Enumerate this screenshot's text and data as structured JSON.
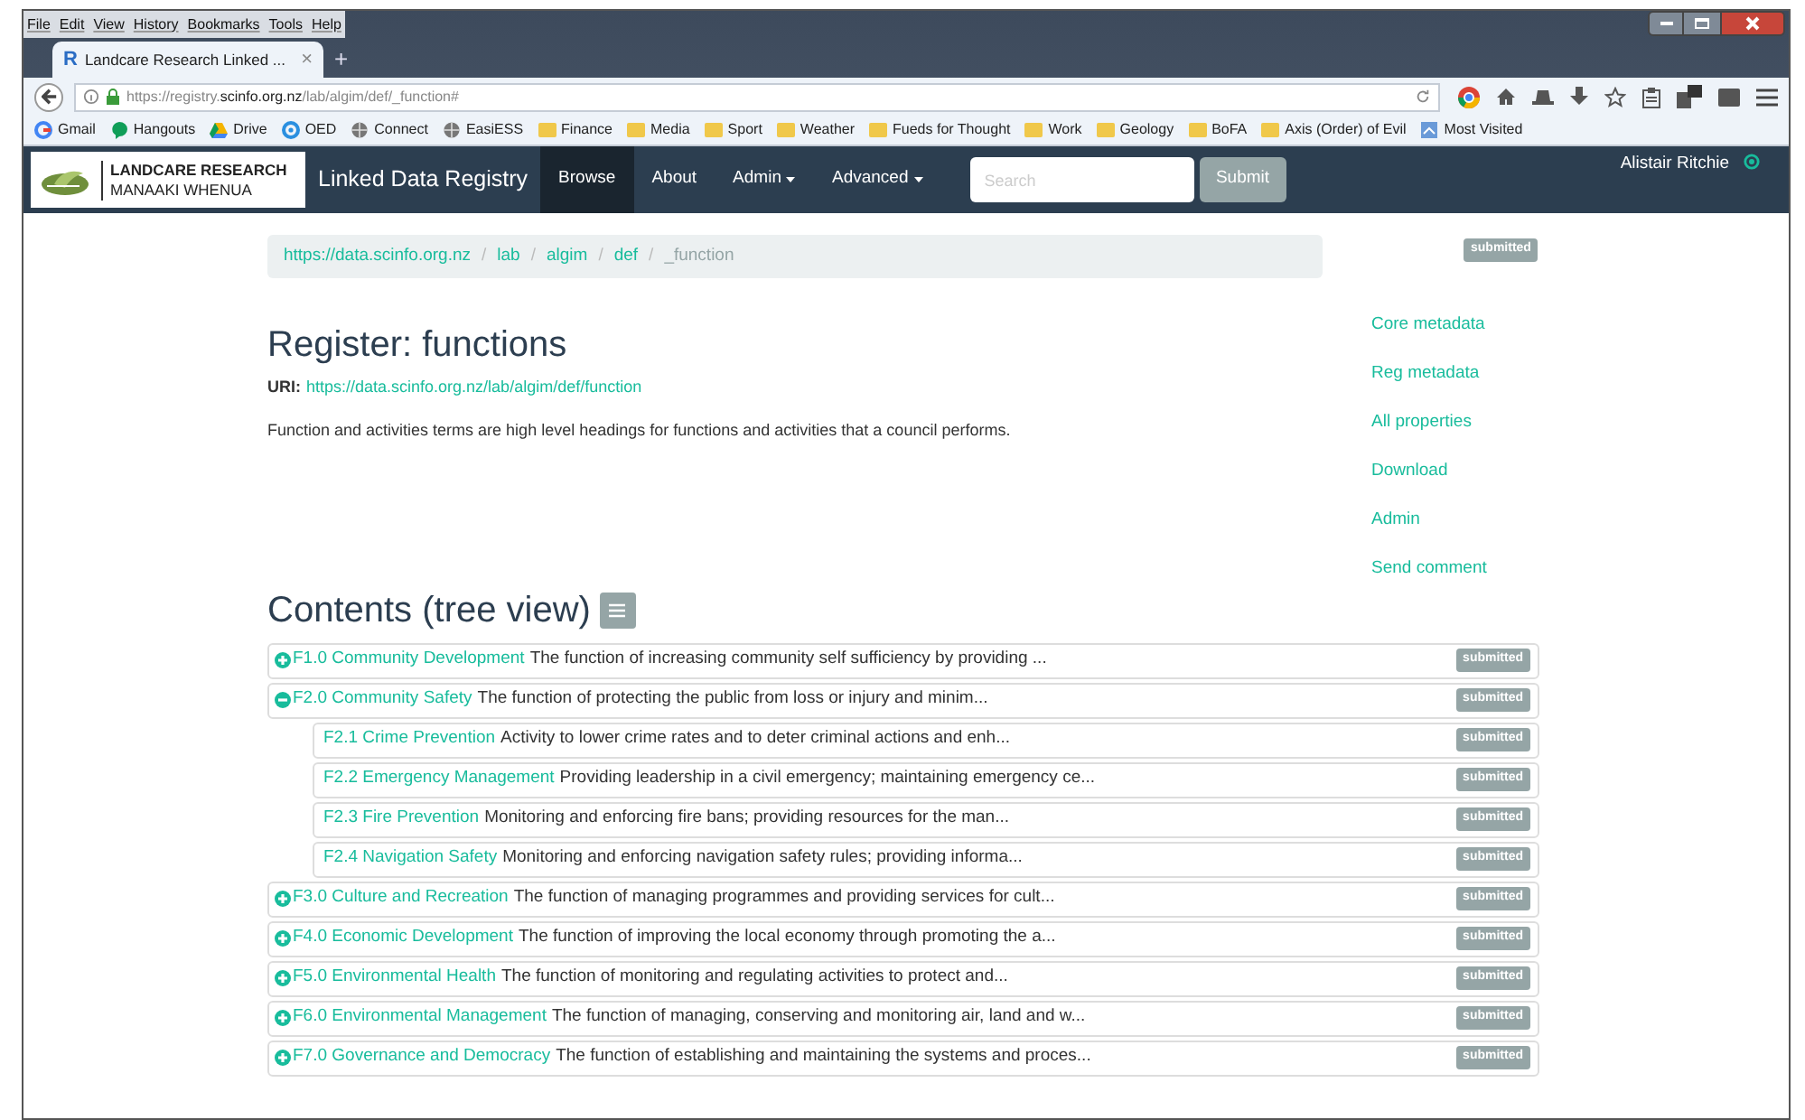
{
  "browser": {
    "menu": [
      "File",
      "Edit",
      "View",
      "History",
      "Bookmarks",
      "Tools",
      "Help"
    ],
    "tab": {
      "icon": "R",
      "title": "Landcare Research Linked ...",
      "close": "×"
    },
    "new_tab": "+",
    "url": {
      "prefix": "https://registry.",
      "host": "scinfo.org.nz",
      "path": "/lab/algim/def/_function#"
    },
    "bookmarks": [
      {
        "label": "Gmail",
        "kind": "google"
      },
      {
        "label": "Hangouts",
        "kind": "chat"
      },
      {
        "label": "Drive",
        "kind": "drive"
      },
      {
        "label": "OED",
        "kind": "ring"
      },
      {
        "label": "Connect",
        "kind": "globe"
      },
      {
        "label": "EasiESS",
        "kind": "globe"
      },
      {
        "label": "Finance",
        "kind": "folder"
      },
      {
        "label": "Media",
        "kind": "folder"
      },
      {
        "label": "Sport",
        "kind": "folder"
      },
      {
        "label": "Weather",
        "kind": "folder"
      },
      {
        "label": "Fueds for Thought",
        "kind": "folder"
      },
      {
        "label": "Work",
        "kind": "folder"
      },
      {
        "label": "Geology",
        "kind": "folder"
      },
      {
        "label": "BoFA",
        "kind": "folder"
      },
      {
        "label": "Axis (Order) of Evil",
        "kind": "folder"
      },
      {
        "label": "Most Visited",
        "kind": "page"
      }
    ]
  },
  "navbar": {
    "logo": {
      "line1": "LANDCARE RESEARCH",
      "line2": "MANAAKI WHENUA"
    },
    "brand": "Linked Data Registry",
    "items": [
      {
        "label": "Browse",
        "selected": true,
        "dropdown": false
      },
      {
        "label": "About",
        "selected": false,
        "dropdown": false
      },
      {
        "label": "Admin",
        "selected": false,
        "dropdown": true
      },
      {
        "label": "Advanced",
        "selected": false,
        "dropdown": true
      }
    ],
    "search": {
      "placeholder": "Search"
    },
    "submit": "Submit",
    "user": "Alistair Ritchie"
  },
  "breadcrumb": [
    {
      "label": "https://data.scinfo.org.nz",
      "link": true
    },
    {
      "separator": "/",
      "label": "lab",
      "link": true
    },
    {
      "separator": "/",
      "label": "algim",
      "link": true
    },
    {
      "separator": "/",
      "label": "def",
      "link": true
    },
    {
      "separator": "/",
      "label": "_function",
      "link": false
    }
  ],
  "status_badge": "submitted",
  "register": {
    "title": "Register: functions",
    "uri_label": "URI:",
    "uri": "https://data.scinfo.org.nz/lab/algim/def/function",
    "description": "Function and activities terms are high level headings for functions and activities that a council performs."
  },
  "side_links": [
    "Core metadata",
    "Reg metadata",
    "All properties",
    "Download",
    "Admin",
    "Send comment"
  ],
  "contents": {
    "title": "Contents (tree view)",
    "items": [
      {
        "name": "F1.0 Community Development",
        "description": "The function of increasing community self sufficiency by providing ...",
        "status": "submitted",
        "expanded": false
      },
      {
        "name": "F2.0 Community Safety",
        "description": "The function of protecting the public from loss or injury and minim...",
        "status": "submitted",
        "expanded": true,
        "children": [
          {
            "name": "F2.1 Crime Prevention",
            "description": "Activity to lower crime rates and to deter criminal actions and enh...",
            "status": "submitted"
          },
          {
            "name": "F2.2 Emergency Management",
            "description": "Providing leadership in a civil emergency; maintaining emergency ce...",
            "status": "submitted"
          },
          {
            "name": "F2.3 Fire Prevention",
            "description": "Monitoring and enforcing fire bans; providing resources for the man...",
            "status": "submitted"
          },
          {
            "name": "F2.4 Navigation Safety",
            "description": "Monitoring and enforcing navigation safety rules; providing informa...",
            "status": "submitted"
          }
        ]
      },
      {
        "name": "F3.0 Culture and Recreation",
        "description": "The function of managing programmes and providing services for cult...",
        "status": "submitted",
        "expanded": false
      },
      {
        "name": "F4.0 Economic Development",
        "description": "The function of improving the local economy through promoting the a...",
        "status": "submitted",
        "expanded": false
      },
      {
        "name": "F5.0 Environmental Health",
        "description": "The function of monitoring and regulating activities to protect and...",
        "status": "submitted",
        "expanded": false
      },
      {
        "name": "F6.0 Environmental Management",
        "description": "The function of managing, conserving and monitoring air, land and w...",
        "status": "submitted",
        "expanded": false
      },
      {
        "name": "F7.0 Governance and Democracy",
        "description": "The function of establishing and maintaining the systems and proces...",
        "status": "submitted",
        "expanded": false
      }
    ]
  }
}
